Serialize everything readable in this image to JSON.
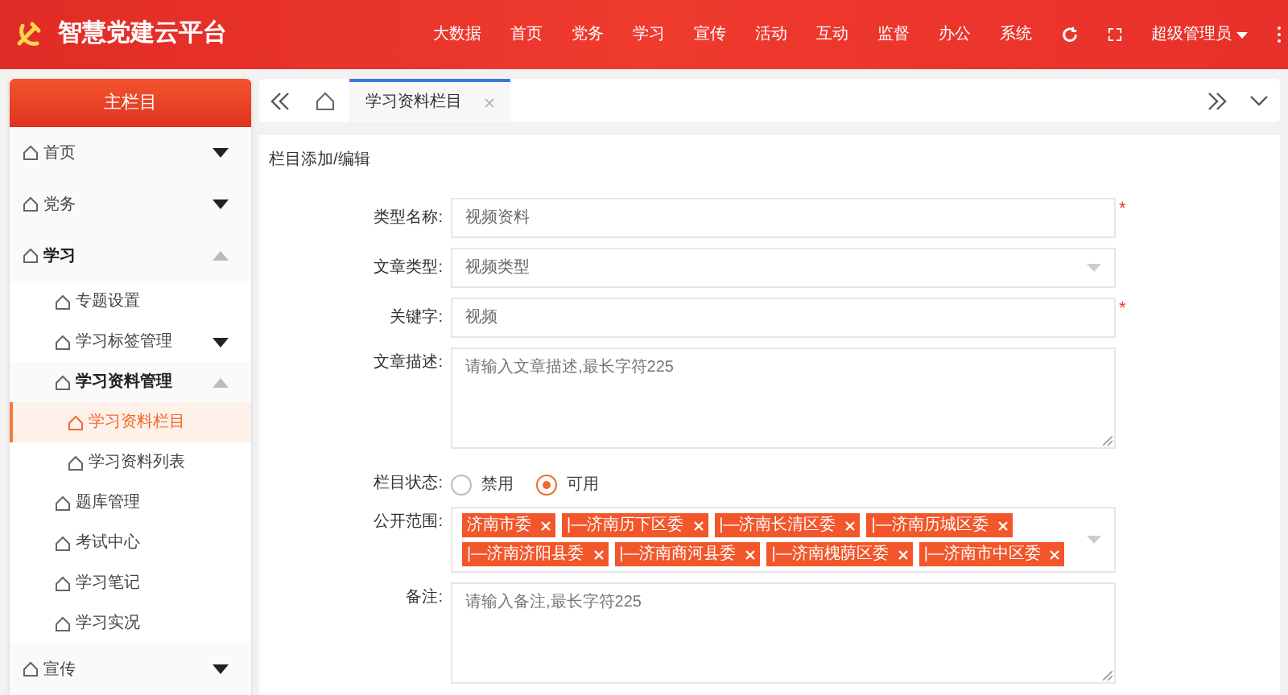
{
  "header": {
    "title": "智慧党建云平台",
    "nav": [
      "大数据",
      "首页",
      "党务",
      "学习",
      "宣传",
      "活动",
      "互动",
      "监督",
      "办公",
      "系统"
    ],
    "user": "超级管理员"
  },
  "sidebar": {
    "title": "主栏目",
    "items": [
      {
        "label": "首页",
        "expanded": false,
        "selected": false
      },
      {
        "label": "党务",
        "expanded": false,
        "selected": false
      },
      {
        "label": "学习",
        "expanded": true,
        "selected": false,
        "children": [
          {
            "label": "专题设置",
            "selected": false
          },
          {
            "label": "学习标签管理",
            "expanded": false,
            "selected": false
          },
          {
            "label": "学习资料管理",
            "expanded": true,
            "selected": false,
            "children": [
              {
                "label": "学习资料栏目",
                "selected": true
              },
              {
                "label": "学习资料列表",
                "selected": false
              }
            ]
          },
          {
            "label": "题库管理",
            "selected": false
          },
          {
            "label": "考试中心",
            "selected": false
          },
          {
            "label": "学习笔记",
            "selected": false
          },
          {
            "label": "学习实况",
            "selected": false
          }
        ]
      },
      {
        "label": "宣传",
        "expanded": false,
        "selected": false
      }
    ]
  },
  "tabs": [
    {
      "label": "学习资料栏目",
      "selected": true
    }
  ],
  "panel": {
    "title": "栏目添加/编辑",
    "fields": [
      {
        "kind": "text",
        "label": "类型名称:",
        "value": "视频资料",
        "required_mark": "*"
      },
      {
        "kind": "select",
        "label": "文章类型:",
        "value": "视频类型"
      },
      {
        "kind": "text",
        "label": "关键字:",
        "value": "视频",
        "required_mark": "*"
      },
      {
        "kind": "textarea",
        "label": "文章描述:",
        "placeholder": "请输入文章描述,最长字符225"
      },
      {
        "kind": "radio",
        "label": "栏目状态:",
        "options": [
          {
            "label": "禁用",
            "selected": false
          },
          {
            "label": "可用",
            "selected": true
          }
        ]
      },
      {
        "kind": "tags",
        "label": "公开范围:",
        "tags": [
          "济南市委",
          "|—济南历下区委",
          "|—济南长清区委",
          "|—济南历城区委",
          "|—济南济阳县委",
          "|—济南商河县委",
          "|—济南槐荫区委",
          "|—济南市中区委"
        ]
      },
      {
        "kind": "textarea",
        "label": "备注:",
        "placeholder": "请输入备注,最长字符225"
      }
    ]
  }
}
